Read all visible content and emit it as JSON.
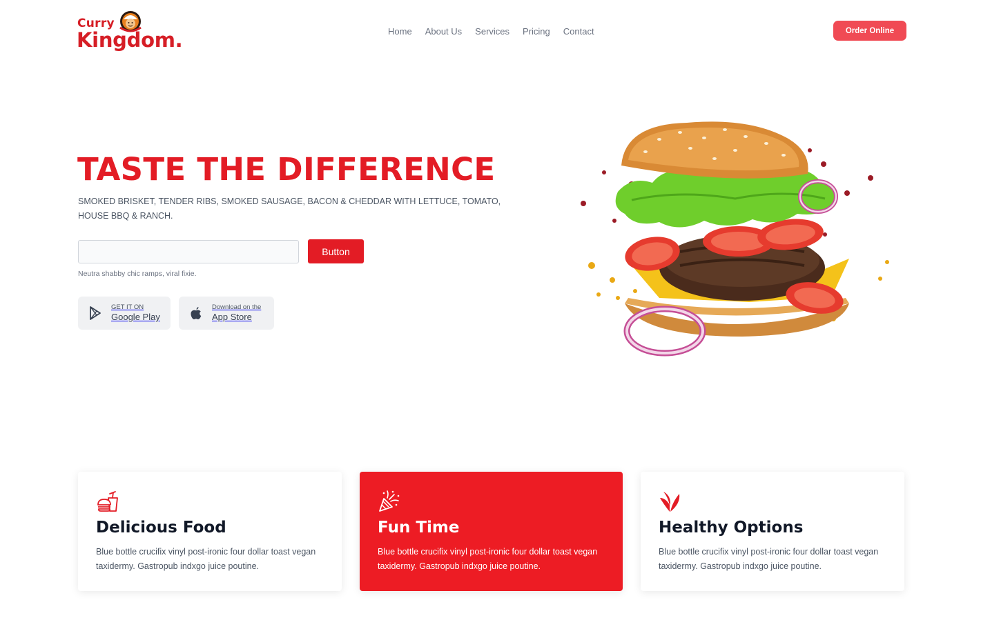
{
  "brand": {
    "line1": "Curry",
    "line2": "Kingdom.",
    "color": "#d61e26"
  },
  "nav": {
    "items": [
      "Home",
      "About Us",
      "Services",
      "Pricing",
      "Contact"
    ]
  },
  "header": {
    "order_label": "Order Online",
    "order_color": "#f04a54"
  },
  "hero": {
    "title": "TASTE THE DIFFERENCE",
    "subtitle": "SMOKED BRISKET, TENDER RIBS, SMOKED SAUSAGE, BACON & CHEDDAR WITH LETTUCE, TOMATO, HOUSE BBQ & RANCH.",
    "input_value": "",
    "input_placeholder": "",
    "button_label": "Button",
    "note": "Neutra shabby chic ramps, viral fixie.",
    "accent": "#e31c25",
    "image_icon": "burger-image"
  },
  "stores": {
    "google": {
      "small": "GET IT ON",
      "big": "Google Play",
      "icon": "google-play-icon"
    },
    "apple": {
      "small": "Download on the",
      "big": "App Store",
      "icon": "apple-icon"
    }
  },
  "features": [
    {
      "title": "Delicious Food",
      "body": "Blue bottle crucifix vinyl post-ironic four dollar toast vegan taxidermy. Gastropub indxgo juice poutine.",
      "icon": "fast-food-icon"
    },
    {
      "title": "Fun Time",
      "body": "Blue bottle crucifix vinyl post-ironic four dollar toast vegan taxidermy. Gastropub indxgo juice poutine.",
      "icon": "party-popper-icon"
    },
    {
      "title": "Healthy Options",
      "body": "Blue bottle crucifix vinyl post-ironic four dollar toast vegan taxidermy. Gastropub indxgo juice poutine.",
      "icon": "leaf-icon"
    }
  ]
}
